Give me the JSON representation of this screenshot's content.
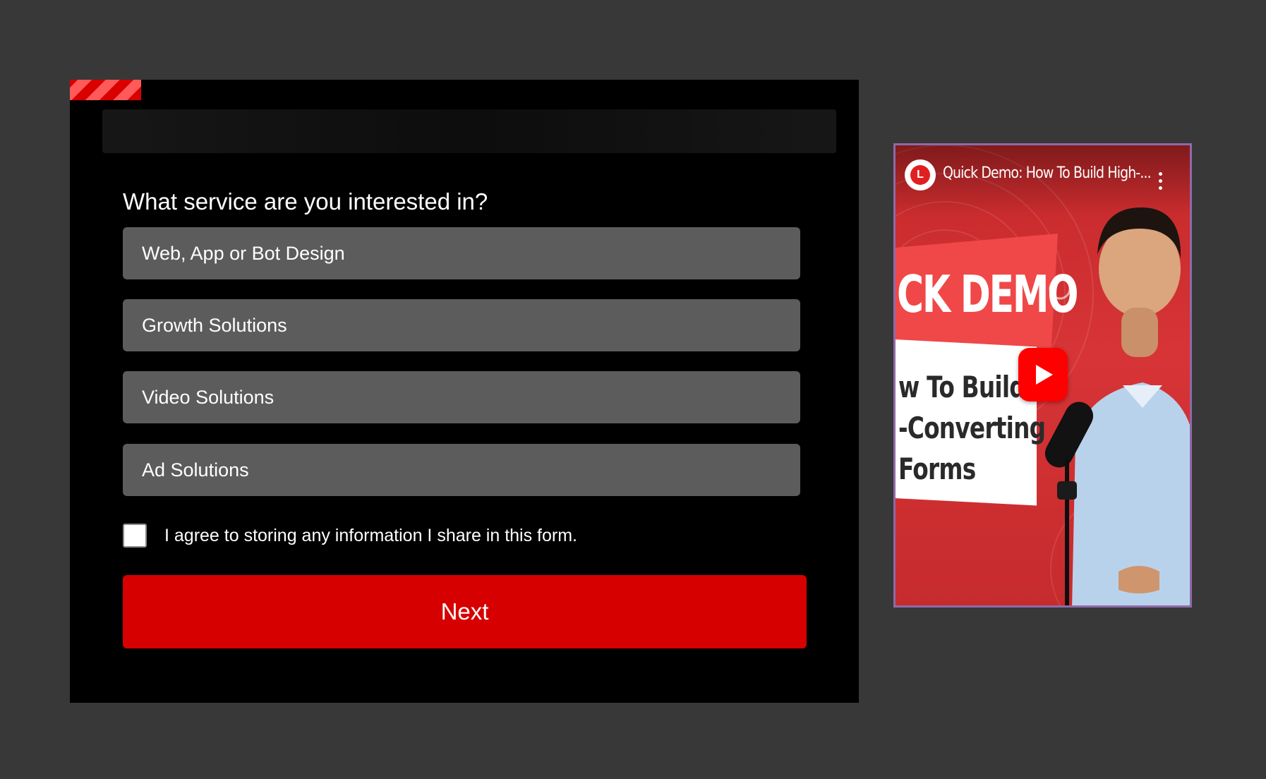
{
  "form": {
    "question": "What service are you interested in?",
    "options": [
      {
        "label": "Web, App or Bot Design"
      },
      {
        "label": "Growth Solutions"
      },
      {
        "label": "Video Solutions"
      },
      {
        "label": "Ad Solutions"
      }
    ],
    "consent": {
      "label": "I agree to storing any information I share in this form.",
      "checked": false
    },
    "next_label": "Next"
  },
  "video": {
    "title": "Quick Demo: How To Build High-...",
    "channel_logo_letter": "L",
    "headline_top": "CK DEMO",
    "headline_lines": [
      "w To Build",
      "-Converting",
      "Forms"
    ]
  },
  "colors": {
    "page_background": "#383838",
    "card_background": "#000000",
    "option_background": "#5c5c5c",
    "accent_red": "#d60000",
    "youtube_red": "#ff0000"
  },
  "icons": {
    "play": "play-icon",
    "menu": "kebab-icon",
    "channel": "channel-logo-icon"
  }
}
